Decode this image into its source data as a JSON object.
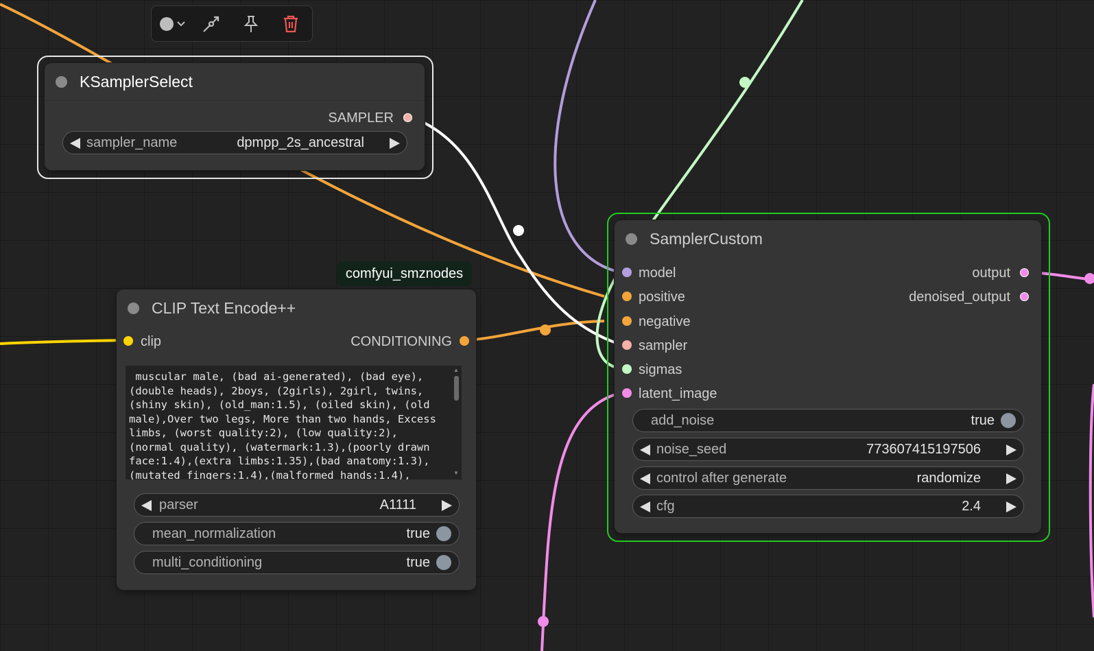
{
  "toolbar": {
    "color_button": "color-picker",
    "bypass_button": "bypass",
    "pin_button": "pin",
    "delete_button": "delete"
  },
  "colors": {
    "orange_link": "#f3a43a",
    "yellow_link": "#ffd500",
    "purple_link": "#b39ddb",
    "green_link": "#c3f7c3",
    "pink_link": "#f08ce8",
    "white_link": "#ffffff",
    "selected_outline": "#22cc22"
  },
  "ksampler_select": {
    "title": "KSamplerSelect",
    "output_label": "SAMPLER",
    "widget_label": "sampler_name",
    "widget_value": "dpmpp_2s_ancestral"
  },
  "clip_encode": {
    "badge": "comfyui_smznodes",
    "title": "CLIP Text Encode++",
    "input_label": "clip",
    "output_label": "CONDITIONING",
    "text": " muscular male, (bad ai-generated), (bad eye),\n(double heads), 2boys, (2girls), 2girl, twins,\n(shiny skin), (old_man:1.5), (oiled skin), (old\nmale),Over two legs, More than two hands, Excess\nlimbs, (worst quality:2), (low quality:2),\n(normal quality), (watermark:1.3),(poorly drawn\nface:1.4),(extra limbs:1.35),(bad anatomy:1.3),\n(mutated fingers:1.4),(malformed hands:1.4),",
    "parser_label": "parser",
    "parser_value": "A1111",
    "mean_norm_label": "mean_normalization",
    "mean_norm_value": "true",
    "multi_cond_label": "multi_conditioning",
    "multi_cond_value": "true"
  },
  "sampler_custom": {
    "title": "SamplerCustom",
    "inputs": [
      "model",
      "positive",
      "negative",
      "sampler",
      "sigmas",
      "latent_image"
    ],
    "outputs": [
      "output",
      "denoised_output"
    ],
    "add_noise_label": "add_noise",
    "add_noise_value": "true",
    "noise_seed_label": "noise_seed",
    "noise_seed_value": "773607415197506",
    "control_label": "control after generate",
    "control_value": "randomize",
    "cfg_label": "cfg",
    "cfg_value": "2.4"
  }
}
